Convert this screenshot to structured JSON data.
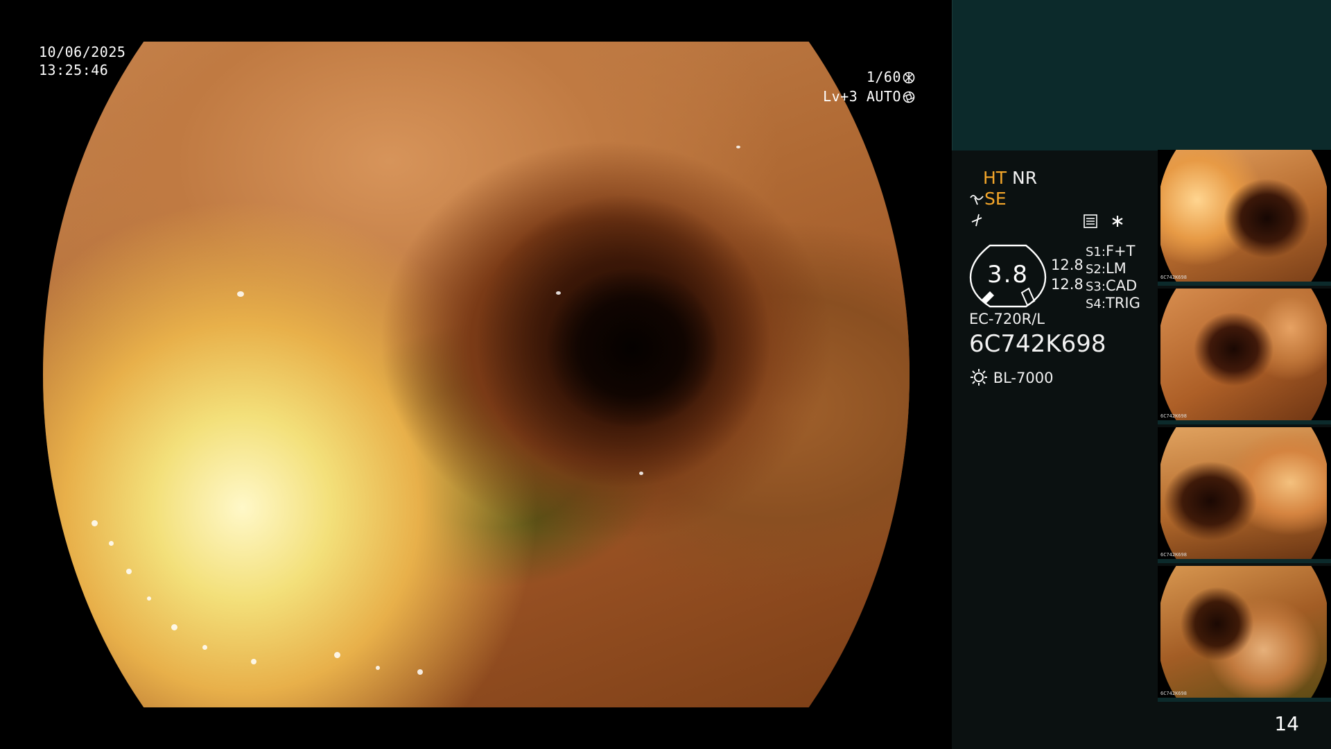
{
  "osd": {
    "date": "10/06/2025",
    "time": "13:25:46",
    "shutter": "1/60",
    "level": "Lv+3",
    "iris_mode": "AUTO"
  },
  "modes": {
    "ht": "HT",
    "nr": "NR",
    "se": "SE"
  },
  "gauge": {
    "value": "3.8",
    "top_reading": "12.8",
    "bottom_reading": "12.8"
  },
  "settings": [
    {
      "key": "S1:",
      "value": "F+T"
    },
    {
      "key": "S2:",
      "value": "LM"
    },
    {
      "key": "S3:",
      "value": "CAD"
    },
    {
      "key": "S4:",
      "value": "TRIG"
    }
  ],
  "device": {
    "scope_model": "EC-720R/L",
    "serial": "6C742K698",
    "light_source": "BL-7000"
  },
  "thumbnails": [
    {
      "caption": "6C742K698"
    },
    {
      "caption": "6C742K698"
    },
    {
      "caption": "6C742K698"
    },
    {
      "caption": "6C742K698"
    }
  ],
  "page_number": "14",
  "colors": {
    "accent_orange": "#f4a62a",
    "panel_teal": "#0c2a2b",
    "panel_dark": "#0b1111"
  },
  "icons": [
    "shutter-icon",
    "iris-icon",
    "structure-enhance-icon",
    "color-enhance-icon",
    "memo-icon",
    "asterisk-icon",
    "light-source-icon"
  ]
}
